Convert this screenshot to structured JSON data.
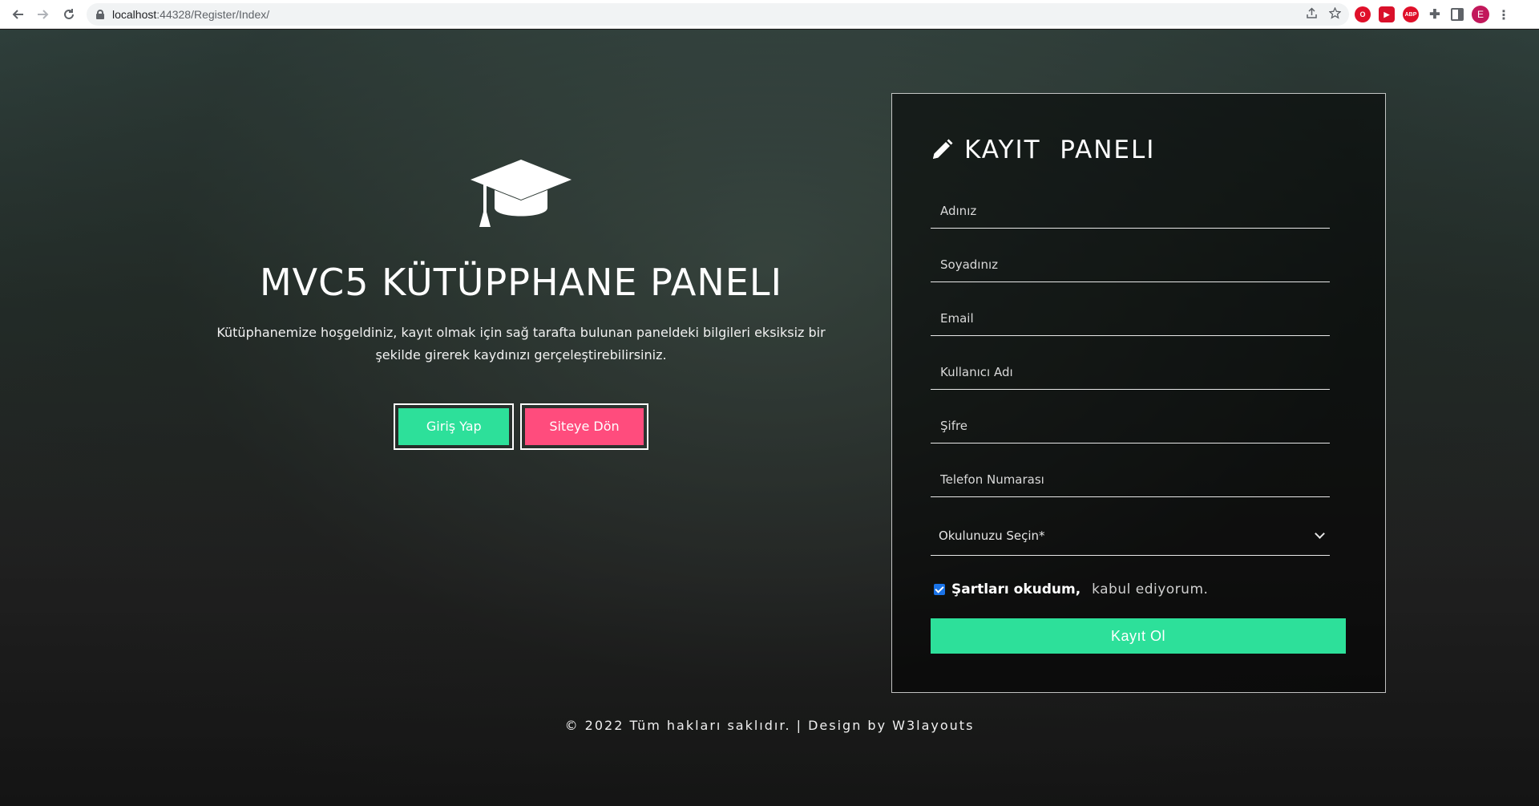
{
  "browser": {
    "url_host": "localhost",
    "url_rest": ":44328/Register/Index/",
    "avatar_letter": "E",
    "extensions": [
      "opera-icon",
      "youtube-icon",
      "abp-icon",
      "puzzle-icon",
      "side-panel-icon"
    ],
    "abp_label": "ABP"
  },
  "hero": {
    "icon": "graduation-cap-icon",
    "title": "MVC5 KÜTÜPPHANE PANELI",
    "description": "Kütüphanemize hoşgeldiniz, kayıt olmak için sağ tarafta bulunan paneldeki bilgileri eksiksiz bir şekilde girerek kaydınızı gerçeleştirebilirsiniz.",
    "login_button": "Giriş Yap",
    "back_button": "Siteye Dön"
  },
  "panel": {
    "icon": "pencil-icon",
    "title": "KAYIT  PANELI",
    "fields": {
      "name": "Adınız",
      "surname": "Soyadınız",
      "email": "Email",
      "username": "Kullanıcı Adı",
      "password": "Şifre",
      "phone": "Telefon Numarası"
    },
    "school_select": "Okulunuzu Seçin*",
    "terms_bold": "Şartları okudum,",
    "terms_rest": " kabul ediyorum.",
    "terms_checked": true,
    "submit": "Kayıt Ol"
  },
  "footer": {
    "text": "© 2022 Tüm hakları saklıdır. | Design by W3layouts"
  },
  "colors": {
    "accent_green": "#2de09a",
    "accent_pink": "#ff4c7d"
  }
}
